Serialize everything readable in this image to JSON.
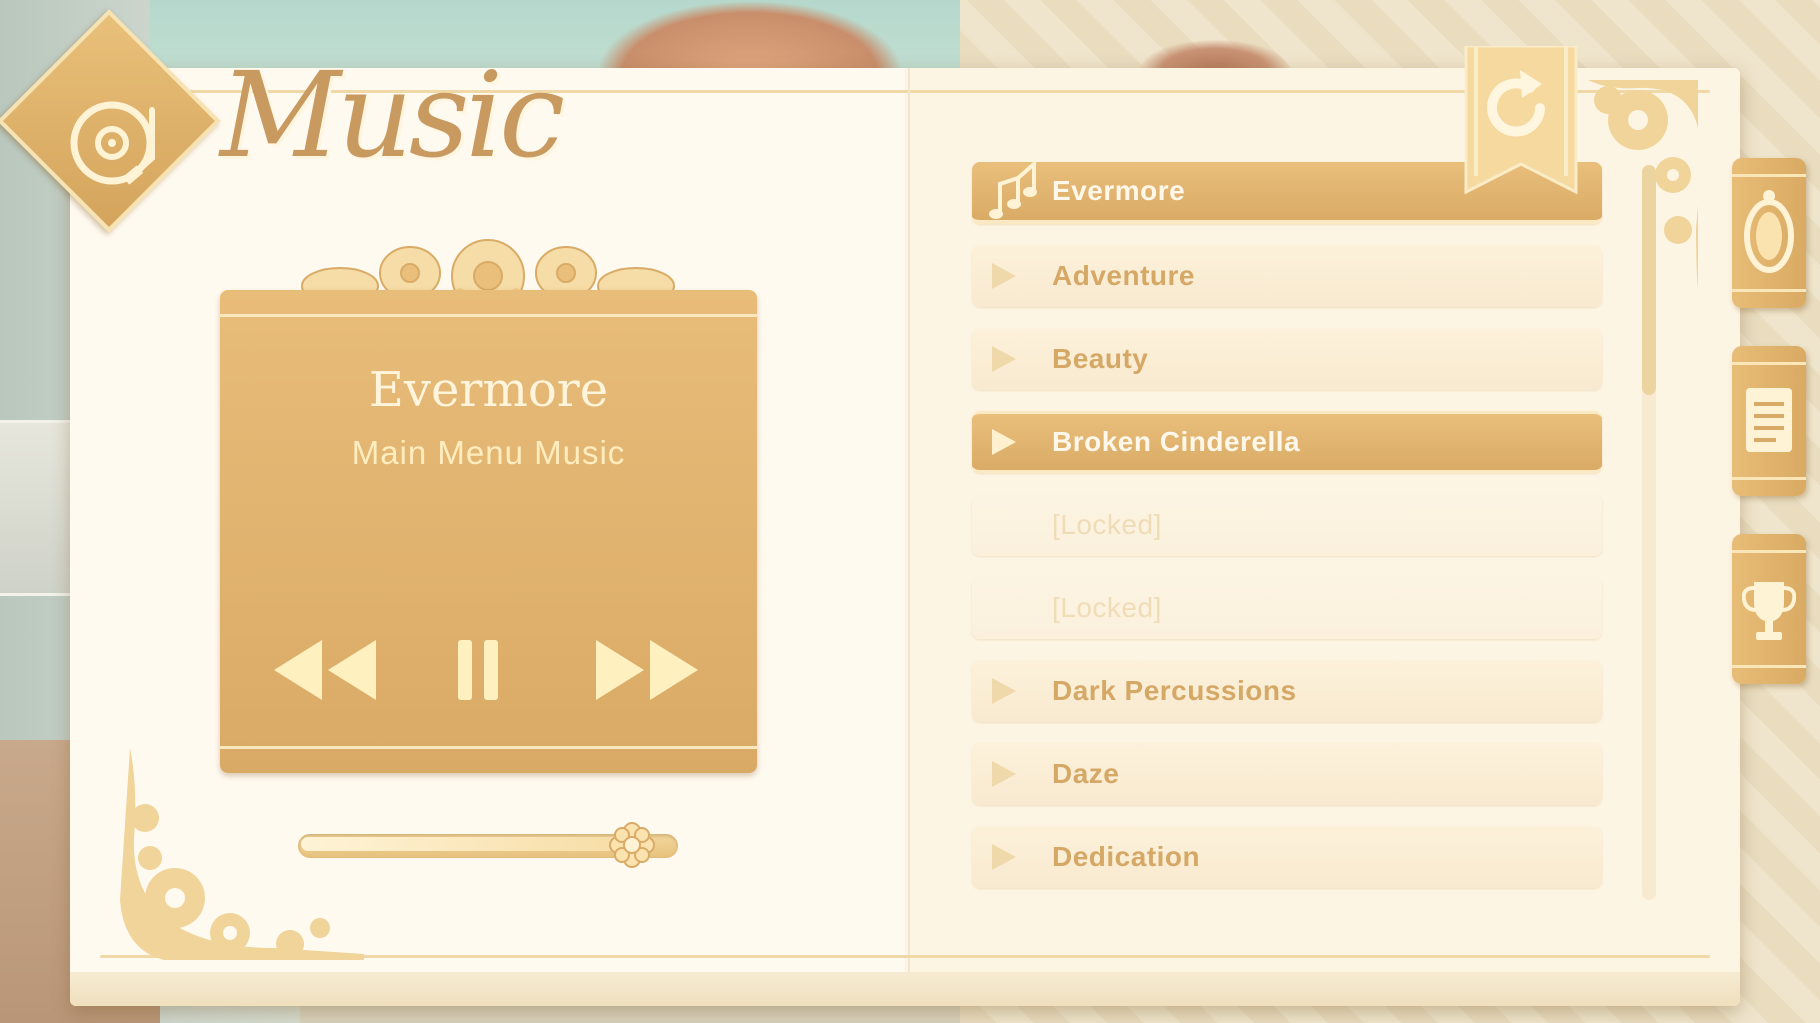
{
  "header": {
    "title": "Music",
    "badge_icon": "turntable-icon"
  },
  "player": {
    "track_title": "Evermore",
    "track_subtitle": "Main Menu Music",
    "controls": [
      "rewind-icon",
      "pause-icon",
      "fast-forward-icon"
    ],
    "volume": 0.88
  },
  "playlist": {
    "items": [
      {
        "label": "Evermore",
        "state": "playing"
      },
      {
        "label": "Adventure",
        "state": "normal"
      },
      {
        "label": "Beauty",
        "state": "normal"
      },
      {
        "label": "Broken Cinderella",
        "state": "selected"
      },
      {
        "label": "[Locked]",
        "state": "locked"
      },
      {
        "label": "[Locked]",
        "state": "locked"
      },
      {
        "label": "Dark Percussions",
        "state": "normal"
      },
      {
        "label": "Daze",
        "state": "normal"
      },
      {
        "label": "Dedication",
        "state": "normal"
      }
    ]
  },
  "side_tabs": [
    "mirror-icon",
    "document-icon",
    "trophy-icon"
  ],
  "colors": {
    "gold": "#d9aa66",
    "gold_light": "#e9bf7b",
    "cream": "#fffaf0",
    "text_gold": "#d5a866",
    "title_gold": "#c89a60"
  }
}
